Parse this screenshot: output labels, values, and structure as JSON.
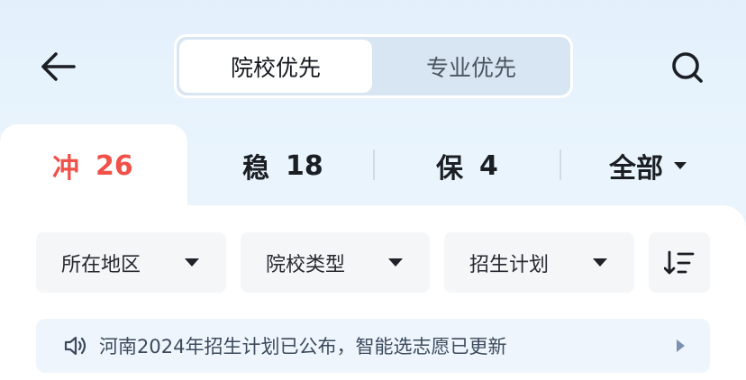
{
  "header": {
    "segment": {
      "active": "院校优先",
      "inactive": "专业优先"
    }
  },
  "tabs": [
    {
      "label": "冲",
      "count": "26"
    },
    {
      "label": "稳",
      "count": "18"
    },
    {
      "label": "保",
      "count": "4"
    }
  ],
  "tab_all": "全部",
  "filters": [
    {
      "label": "所在地区"
    },
    {
      "label": "院校类型"
    },
    {
      "label": "招生计划"
    }
  ],
  "notice": {
    "text": "河南2024年招生计划已公布，智能选志愿已更新"
  },
  "colors": {
    "accent_red": "#f0524a",
    "notice_bg": "#eef5fc",
    "segment_bg": "#d7e6f2"
  }
}
